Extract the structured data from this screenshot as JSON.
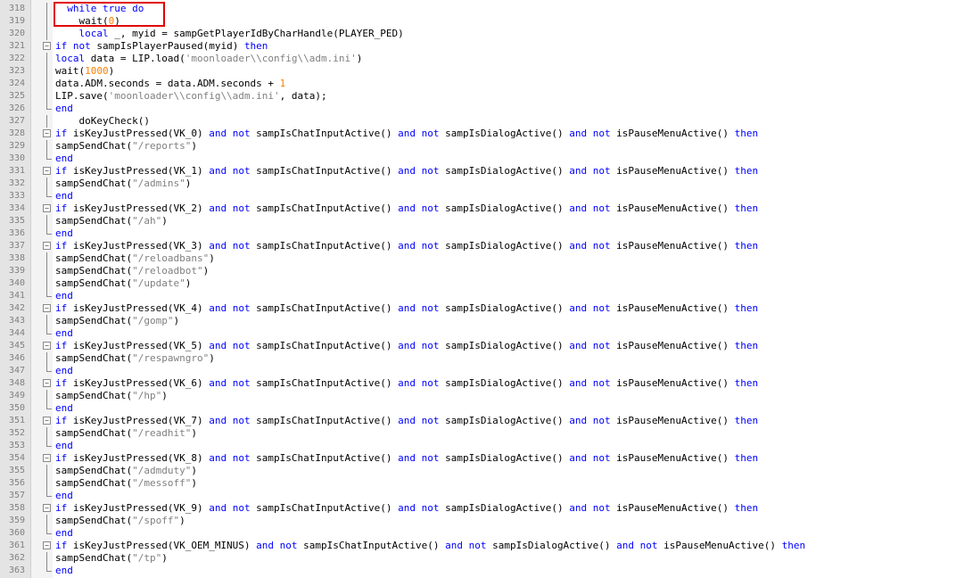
{
  "editor": {
    "colors": {
      "keyword": "#0000ff",
      "number": "#ff8000",
      "string": "#808080",
      "text": "#000000",
      "highlight_box": "#e00000"
    },
    "lines": [
      {
        "n": "318",
        "fold": "vline",
        "tokens": [
          {
            "t": "  ",
            "c": "t"
          },
          {
            "t": "while true do",
            "c": "k"
          }
        ]
      },
      {
        "n": "319",
        "fold": "vline",
        "tokens": [
          {
            "t": "    wait(",
            "c": "t"
          },
          {
            "t": "0",
            "c": "n"
          },
          {
            "t": ")",
            "c": "t"
          }
        ]
      },
      {
        "n": "320",
        "fold": "vline",
        "tokens": [
          {
            "t": "    ",
            "c": "t"
          },
          {
            "t": "local",
            "c": "k"
          },
          {
            "t": " _, myid = sampGetPlayerIdByCharHandle(PLAYER_PED)",
            "c": "t"
          }
        ]
      },
      {
        "n": "321",
        "fold": "box",
        "tokens": [
          {
            "t": "if not",
            "c": "k"
          },
          {
            "t": " sampIsPlayerPaused(myid) ",
            "c": "t"
          },
          {
            "t": "then",
            "c": "k"
          }
        ]
      },
      {
        "n": "322",
        "fold": "vline",
        "tokens": [
          {
            "t": "local",
            "c": "k"
          },
          {
            "t": " data = LIP.load(",
            "c": "t"
          },
          {
            "t": "'moonloader\\\\config\\\\adm.ini'",
            "c": "s"
          },
          {
            "t": ")",
            "c": "t"
          }
        ]
      },
      {
        "n": "323",
        "fold": "vline",
        "tokens": [
          {
            "t": "wait(",
            "c": "t"
          },
          {
            "t": "1000",
            "c": "n"
          },
          {
            "t": ")",
            "c": "t"
          }
        ]
      },
      {
        "n": "324",
        "fold": "vline",
        "tokens": [
          {
            "t": "data.ADM.seconds = data.ADM.seconds + ",
            "c": "t"
          },
          {
            "t": "1",
            "c": "n"
          }
        ]
      },
      {
        "n": "325",
        "fold": "vline",
        "tokens": [
          {
            "t": "LIP.save(",
            "c": "t"
          },
          {
            "t": "'moonloader\\\\config\\\\adm.ini'",
            "c": "s"
          },
          {
            "t": ", data);",
            "c": "t"
          }
        ]
      },
      {
        "n": "326",
        "fold": "end",
        "tokens": [
          {
            "t": "end",
            "c": "k"
          }
        ]
      },
      {
        "n": "327",
        "fold": "vline",
        "tokens": [
          {
            "t": "    doKeyCheck()",
            "c": "t"
          }
        ]
      },
      {
        "n": "328",
        "fold": "box",
        "tokens": [
          {
            "t": "if",
            "c": "k"
          },
          {
            "t": " isKeyJustPressed(VK_0) ",
            "c": "t"
          },
          {
            "t": "and not",
            "c": "k"
          },
          {
            "t": " sampIsChatInputActive() ",
            "c": "t"
          },
          {
            "t": "and not",
            "c": "k"
          },
          {
            "t": " sampIsDialogActive() ",
            "c": "t"
          },
          {
            "t": "and not",
            "c": "k"
          },
          {
            "t": " isPauseMenuActive() ",
            "c": "t"
          },
          {
            "t": "then",
            "c": "k"
          }
        ]
      },
      {
        "n": "329",
        "fold": "vline",
        "tokens": [
          {
            "t": "sampSendChat(",
            "c": "t"
          },
          {
            "t": "\"/reports\"",
            "c": "s"
          },
          {
            "t": ")",
            "c": "t"
          }
        ]
      },
      {
        "n": "330",
        "fold": "end",
        "tokens": [
          {
            "t": "end",
            "c": "k"
          }
        ]
      },
      {
        "n": "331",
        "fold": "box",
        "tokens": [
          {
            "t": "if",
            "c": "k"
          },
          {
            "t": " isKeyJustPressed(VK_1) ",
            "c": "t"
          },
          {
            "t": "and not",
            "c": "k"
          },
          {
            "t": " sampIsChatInputActive() ",
            "c": "t"
          },
          {
            "t": "and not",
            "c": "k"
          },
          {
            "t": " sampIsDialogActive() ",
            "c": "t"
          },
          {
            "t": "and not",
            "c": "k"
          },
          {
            "t": " isPauseMenuActive() ",
            "c": "t"
          },
          {
            "t": "then",
            "c": "k"
          }
        ]
      },
      {
        "n": "332",
        "fold": "vline",
        "tokens": [
          {
            "t": "sampSendChat(",
            "c": "t"
          },
          {
            "t": "\"/admins\"",
            "c": "s"
          },
          {
            "t": ")",
            "c": "t"
          }
        ]
      },
      {
        "n": "333",
        "fold": "end",
        "tokens": [
          {
            "t": "end",
            "c": "k"
          }
        ]
      },
      {
        "n": "334",
        "fold": "box",
        "tokens": [
          {
            "t": "if",
            "c": "k"
          },
          {
            "t": " isKeyJustPressed(VK_2) ",
            "c": "t"
          },
          {
            "t": "and not",
            "c": "k"
          },
          {
            "t": " sampIsChatInputActive() ",
            "c": "t"
          },
          {
            "t": "and not",
            "c": "k"
          },
          {
            "t": " sampIsDialogActive() ",
            "c": "t"
          },
          {
            "t": "and not",
            "c": "k"
          },
          {
            "t": " isPauseMenuActive() ",
            "c": "t"
          },
          {
            "t": "then",
            "c": "k"
          }
        ]
      },
      {
        "n": "335",
        "fold": "vline",
        "tokens": [
          {
            "t": "sampSendChat(",
            "c": "t"
          },
          {
            "t": "\"/ah\"",
            "c": "s"
          },
          {
            "t": ")",
            "c": "t"
          }
        ]
      },
      {
        "n": "336",
        "fold": "end",
        "tokens": [
          {
            "t": "end",
            "c": "k"
          }
        ]
      },
      {
        "n": "337",
        "fold": "box",
        "tokens": [
          {
            "t": "if",
            "c": "k"
          },
          {
            "t": " isKeyJustPressed(VK_3) ",
            "c": "t"
          },
          {
            "t": "and not",
            "c": "k"
          },
          {
            "t": " sampIsChatInputActive() ",
            "c": "t"
          },
          {
            "t": "and not",
            "c": "k"
          },
          {
            "t": " sampIsDialogActive() ",
            "c": "t"
          },
          {
            "t": "and not",
            "c": "k"
          },
          {
            "t": " isPauseMenuActive() ",
            "c": "t"
          },
          {
            "t": "then",
            "c": "k"
          }
        ]
      },
      {
        "n": "338",
        "fold": "vline",
        "tokens": [
          {
            "t": "sampSendChat(",
            "c": "t"
          },
          {
            "t": "\"/reloadbans\"",
            "c": "s"
          },
          {
            "t": ")",
            "c": "t"
          }
        ]
      },
      {
        "n": "339",
        "fold": "vline",
        "tokens": [
          {
            "t": "sampSendChat(",
            "c": "t"
          },
          {
            "t": "\"/reloadbot\"",
            "c": "s"
          },
          {
            "t": ")",
            "c": "t"
          }
        ]
      },
      {
        "n": "340",
        "fold": "vline",
        "tokens": [
          {
            "t": "sampSendChat(",
            "c": "t"
          },
          {
            "t": "\"/update\"",
            "c": "s"
          },
          {
            "t": ")",
            "c": "t"
          }
        ]
      },
      {
        "n": "341",
        "fold": "end",
        "tokens": [
          {
            "t": "end",
            "c": "k"
          }
        ]
      },
      {
        "n": "342",
        "fold": "box",
        "tokens": [
          {
            "t": "if",
            "c": "k"
          },
          {
            "t": " isKeyJustPressed(VK_4) ",
            "c": "t"
          },
          {
            "t": "and not",
            "c": "k"
          },
          {
            "t": " sampIsChatInputActive() ",
            "c": "t"
          },
          {
            "t": "and not",
            "c": "k"
          },
          {
            "t": " sampIsDialogActive() ",
            "c": "t"
          },
          {
            "t": "and not",
            "c": "k"
          },
          {
            "t": " isPauseMenuActive() ",
            "c": "t"
          },
          {
            "t": "then",
            "c": "k"
          }
        ]
      },
      {
        "n": "343",
        "fold": "vline",
        "tokens": [
          {
            "t": "sampSendChat(",
            "c": "t"
          },
          {
            "t": "\"/gomp\"",
            "c": "s"
          },
          {
            "t": ")",
            "c": "t"
          }
        ]
      },
      {
        "n": "344",
        "fold": "end",
        "tokens": [
          {
            "t": "end",
            "c": "k"
          }
        ]
      },
      {
        "n": "345",
        "fold": "box",
        "tokens": [
          {
            "t": "if",
            "c": "k"
          },
          {
            "t": " isKeyJustPressed(VK_5) ",
            "c": "t"
          },
          {
            "t": "and not",
            "c": "k"
          },
          {
            "t": " sampIsChatInputActive() ",
            "c": "t"
          },
          {
            "t": "and not",
            "c": "k"
          },
          {
            "t": " sampIsDialogActive() ",
            "c": "t"
          },
          {
            "t": "and not",
            "c": "k"
          },
          {
            "t": " isPauseMenuActive() ",
            "c": "t"
          },
          {
            "t": "then",
            "c": "k"
          }
        ]
      },
      {
        "n": "346",
        "fold": "vline",
        "tokens": [
          {
            "t": "sampSendChat(",
            "c": "t"
          },
          {
            "t": "\"/respawngro\"",
            "c": "s"
          },
          {
            "t": ")",
            "c": "t"
          }
        ]
      },
      {
        "n": "347",
        "fold": "end",
        "tokens": [
          {
            "t": "end",
            "c": "k"
          }
        ]
      },
      {
        "n": "348",
        "fold": "box",
        "tokens": [
          {
            "t": "if",
            "c": "k"
          },
          {
            "t": " isKeyJustPressed(VK_6) ",
            "c": "t"
          },
          {
            "t": "and not",
            "c": "k"
          },
          {
            "t": " sampIsChatInputActive() ",
            "c": "t"
          },
          {
            "t": "and not",
            "c": "k"
          },
          {
            "t": " sampIsDialogActive() ",
            "c": "t"
          },
          {
            "t": "and not",
            "c": "k"
          },
          {
            "t": " isPauseMenuActive() ",
            "c": "t"
          },
          {
            "t": "then",
            "c": "k"
          }
        ]
      },
      {
        "n": "349",
        "fold": "vline",
        "tokens": [
          {
            "t": "sampSendChat(",
            "c": "t"
          },
          {
            "t": "\"/hp\"",
            "c": "s"
          },
          {
            "t": ")",
            "c": "t"
          }
        ]
      },
      {
        "n": "350",
        "fold": "end",
        "tokens": [
          {
            "t": "end",
            "c": "k"
          }
        ]
      },
      {
        "n": "351",
        "fold": "box",
        "tokens": [
          {
            "t": "if",
            "c": "k"
          },
          {
            "t": " isKeyJustPressed(VK_7) ",
            "c": "t"
          },
          {
            "t": "and not",
            "c": "k"
          },
          {
            "t": " sampIsChatInputActive() ",
            "c": "t"
          },
          {
            "t": "and not",
            "c": "k"
          },
          {
            "t": " sampIsDialogActive() ",
            "c": "t"
          },
          {
            "t": "and not",
            "c": "k"
          },
          {
            "t": " isPauseMenuActive() ",
            "c": "t"
          },
          {
            "t": "then",
            "c": "k"
          }
        ]
      },
      {
        "n": "352",
        "fold": "vline",
        "tokens": [
          {
            "t": "sampSendChat(",
            "c": "t"
          },
          {
            "t": "\"/readhit\"",
            "c": "s"
          },
          {
            "t": ")",
            "c": "t"
          }
        ]
      },
      {
        "n": "353",
        "fold": "end",
        "tokens": [
          {
            "t": "end",
            "c": "k"
          }
        ]
      },
      {
        "n": "354",
        "fold": "box",
        "tokens": [
          {
            "t": "if",
            "c": "k"
          },
          {
            "t": " isKeyJustPressed(VK_8) ",
            "c": "t"
          },
          {
            "t": "and not",
            "c": "k"
          },
          {
            "t": " sampIsChatInputActive() ",
            "c": "t"
          },
          {
            "t": "and not",
            "c": "k"
          },
          {
            "t": " sampIsDialogActive() ",
            "c": "t"
          },
          {
            "t": "and not",
            "c": "k"
          },
          {
            "t": " isPauseMenuActive() ",
            "c": "t"
          },
          {
            "t": "then",
            "c": "k"
          }
        ]
      },
      {
        "n": "355",
        "fold": "vline",
        "tokens": [
          {
            "t": "sampSendChat(",
            "c": "t"
          },
          {
            "t": "\"/admduty\"",
            "c": "s"
          },
          {
            "t": ")",
            "c": "t"
          }
        ]
      },
      {
        "n": "356",
        "fold": "vline",
        "tokens": [
          {
            "t": "sampSendChat(",
            "c": "t"
          },
          {
            "t": "\"/messoff\"",
            "c": "s"
          },
          {
            "t": ")",
            "c": "t"
          }
        ]
      },
      {
        "n": "357",
        "fold": "end",
        "tokens": [
          {
            "t": "end",
            "c": "k"
          }
        ]
      },
      {
        "n": "358",
        "fold": "box",
        "tokens": [
          {
            "t": "if",
            "c": "k"
          },
          {
            "t": " isKeyJustPressed(VK_9) ",
            "c": "t"
          },
          {
            "t": "and not",
            "c": "k"
          },
          {
            "t": " sampIsChatInputActive() ",
            "c": "t"
          },
          {
            "t": "and not",
            "c": "k"
          },
          {
            "t": " sampIsDialogActive() ",
            "c": "t"
          },
          {
            "t": "and not",
            "c": "k"
          },
          {
            "t": " isPauseMenuActive() ",
            "c": "t"
          },
          {
            "t": "then",
            "c": "k"
          }
        ]
      },
      {
        "n": "359",
        "fold": "vline",
        "tokens": [
          {
            "t": "sampSendChat(",
            "c": "t"
          },
          {
            "t": "\"/spoff\"",
            "c": "s"
          },
          {
            "t": ")",
            "c": "t"
          }
        ]
      },
      {
        "n": "360",
        "fold": "end",
        "tokens": [
          {
            "t": "end",
            "c": "k"
          }
        ]
      },
      {
        "n": "361",
        "fold": "box",
        "tokens": [
          {
            "t": "if",
            "c": "k"
          },
          {
            "t": " isKeyJustPressed(VK_OEM_MINUS) ",
            "c": "t"
          },
          {
            "t": "and not",
            "c": "k"
          },
          {
            "t": " sampIsChatInputActive() ",
            "c": "t"
          },
          {
            "t": "and not",
            "c": "k"
          },
          {
            "t": " sampIsDialogActive() ",
            "c": "t"
          },
          {
            "t": "and not",
            "c": "k"
          },
          {
            "t": " isPauseMenuActive() ",
            "c": "t"
          },
          {
            "t": "then",
            "c": "k"
          }
        ]
      },
      {
        "n": "362",
        "fold": "vline",
        "tokens": [
          {
            "t": "sampSendChat(",
            "c": "t"
          },
          {
            "t": "\"/tp\"",
            "c": "s"
          },
          {
            "t": ")",
            "c": "t"
          }
        ]
      },
      {
        "n": "363",
        "fold": "end",
        "tokens": [
          {
            "t": "end",
            "c": "k"
          }
        ]
      }
    ]
  }
}
